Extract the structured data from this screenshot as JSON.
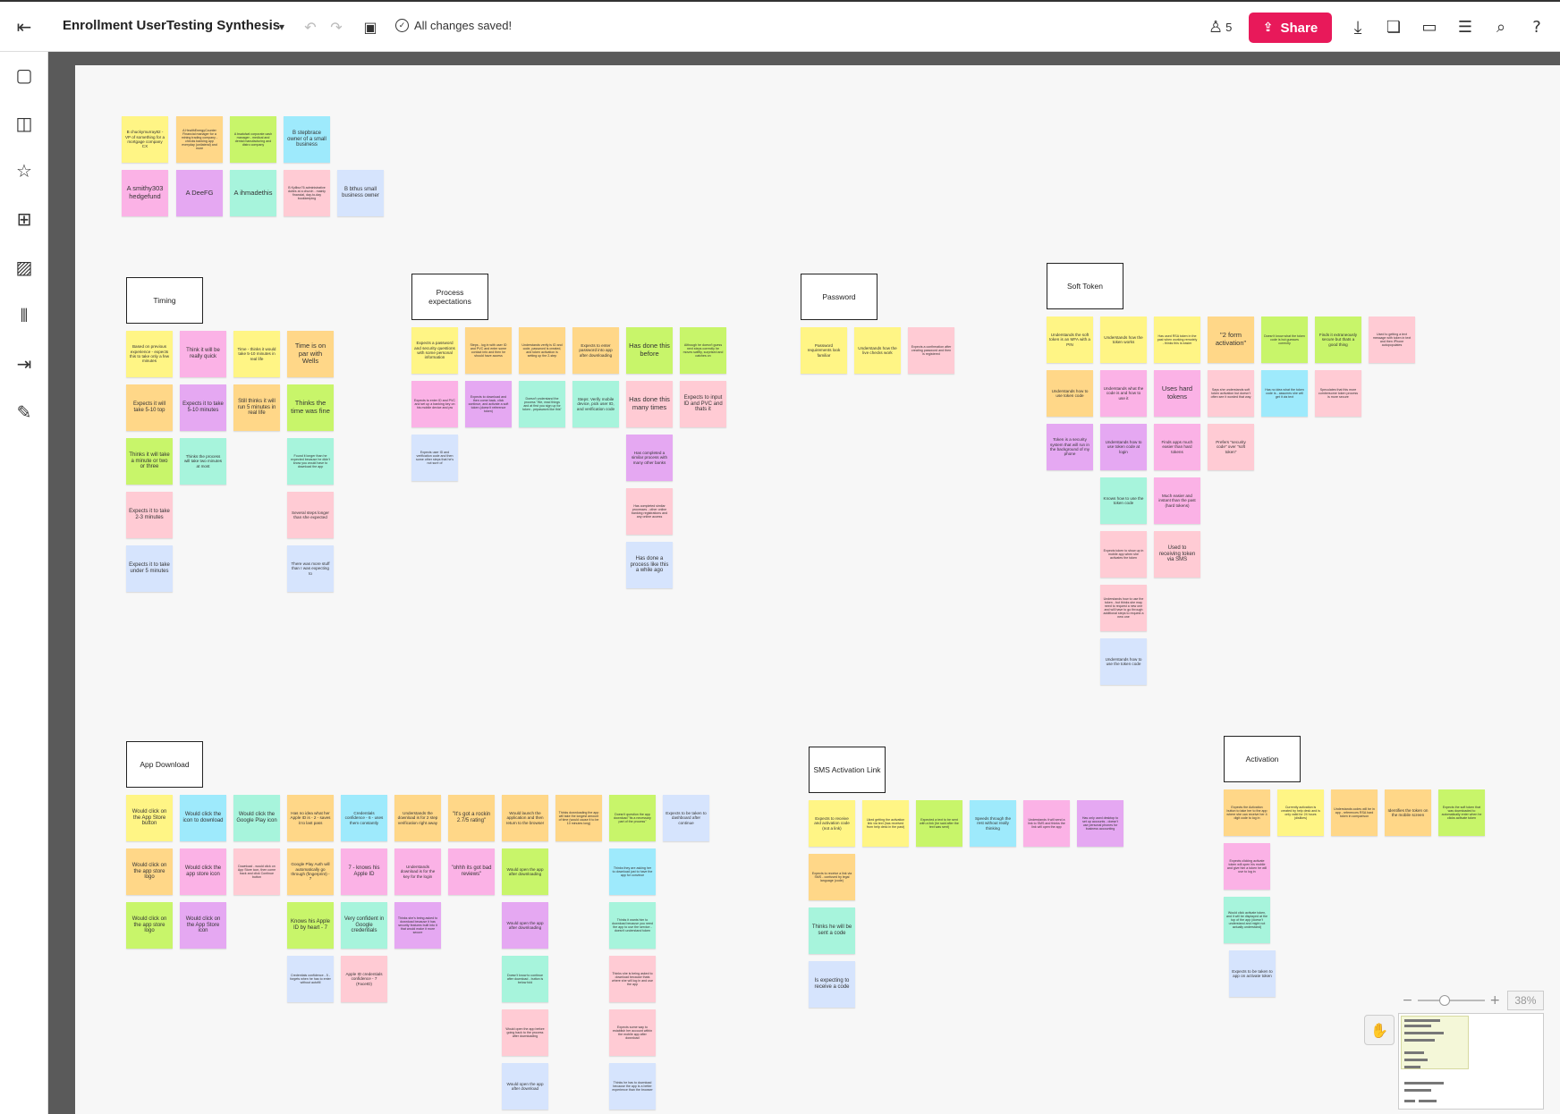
{
  "topbar": {
    "title": "Enrollment UserTesting Synthesis",
    "save_status": "All changes saved!",
    "collaborators_count": "5",
    "share_label": "Share",
    "icons": [
      "exit-icon",
      "chevron-down-icon",
      "undo-icon",
      "redo-icon",
      "present-icon",
      "check-circle-icon",
      "person-icon",
      "share-upload-icon",
      "download-icon",
      "comments-icon",
      "chat-icon",
      "activity-icon",
      "search-icon",
      "help-icon"
    ]
  },
  "leftbar": {
    "icons": [
      "sticky-note-icon",
      "shapes-icon",
      "star-icon",
      "grid-icon",
      "image-icon",
      "library-icon",
      "import-icon",
      "pen-icon"
    ]
  },
  "participants": {
    "row1": [
      {
        "text": "B chuckymurray82 - VP of something for a mortgage company CX",
        "color": "yellow"
      },
      {
        "text": "A HealthEnergyCounter Financial manager for a mining trading company - checks banking app everyday (unilateral) and more",
        "color": "orange"
      },
      {
        "text": "A bsatulwd corporate cash manager - medical and dental manufacturing and distro company",
        "color": "green"
      },
      {
        "text": "B stepbrace owner of a small business",
        "color": "cyan"
      }
    ],
    "row2": [
      {
        "text": "A smithy303 hedgefund",
        "color": "pink"
      },
      {
        "text": "A DeeFG",
        "color": "purple"
      },
      {
        "text": "A ihmadethis",
        "color": "teal"
      },
      {
        "text": "B Kyllbur76 administrative duties at a church - mainly financial, day-to-day bookkeeping",
        "color": "salmon"
      },
      {
        "text": "B bthus small business owner",
        "color": "blue"
      }
    ]
  },
  "timing": {
    "label": "Timing",
    "columns": [
      [
        {
          "text": "Based on previous experience - expects this to take only a few minutes",
          "color": "yellow"
        },
        {
          "text": "Expects it will take 5-10 top",
          "color": "orange"
        },
        {
          "text": "Thinks it will take a minute or two or three",
          "color": "green"
        },
        {
          "text": "Expects it to take 2-3 minutes",
          "color": "salmon"
        },
        {
          "text": "Expects it to take under 5 minutes",
          "color": "blue"
        }
      ],
      [
        {
          "text": "Think it will be really quick",
          "color": "pink"
        },
        {
          "text": "Expects it to take 5-10 minutes",
          "color": "purple"
        },
        {
          "text": "Thinks the process will take two minutes at most",
          "color": "teal"
        }
      ],
      [
        {
          "text": "Time - thinks it would take 5-10 minutes in real life",
          "color": "yellow"
        },
        {
          "text": "Still thinks it will run 5 minutes in real life",
          "color": "orange"
        }
      ],
      [
        {
          "text": "Time is on par with Wells",
          "color": "orange"
        },
        {
          "text": "Thinks the time was fine",
          "color": "green"
        },
        {
          "text": "Found it longer than he expected because he didn't know you would have to download the app",
          "color": "teal"
        },
        {
          "text": "Several steps longer than she expected",
          "color": "salmon"
        },
        {
          "text": "There was more stuff than I was expecting to",
          "color": "blue"
        }
      ]
    ]
  },
  "process": {
    "label": "Process expectations",
    "row1": [
      {
        "text": "Expects a password and security questions with some personal information",
        "color": "yellow"
      },
      {
        "text": "Steps - log in with user ID and PVC and enter some contact info and then he should have access",
        "color": "orange"
      },
      {
        "text": "Understands verify is ID and code, password is created, and token activation is setting up the 2-step",
        "color": "orange"
      },
      {
        "text": "Expects to enter password into app after downloading",
        "color": "orange"
      },
      {
        "text": "Has done this before",
        "color": "green"
      },
      {
        "text": "Although he doesn't guess next steps correctly he moves swiftly, surprised and catches on",
        "color": "green"
      }
    ],
    "row2": [
      {
        "text": "Expects to enter ID and PVC and set up a banking key on his mobile device and pw",
        "color": "pink"
      },
      {
        "text": "Expects to download and then come back, click continue, and activate a soft token (doesn't reference token)",
        "color": "purple"
      },
      {
        "text": "Doesn't understand the process \"We, read things and at first you sign up for token - pepaswork like this\"",
        "color": "teal"
      },
      {
        "text": "Steps: Verify mobile device, pick user ID, and verification code",
        "color": "teal"
      },
      {
        "text": "Has done this many times",
        "color": "salmon"
      },
      {
        "text": "Expects to input ID and PVC and thats it",
        "color": "salmon"
      }
    ],
    "extra_left": {
      "text": "Expects user ID and verification code and then some other steps that he's not sure of",
      "color": "blue"
    },
    "column": [
      {
        "text": "Has completed a similar process with many other banks",
        "color": "purple"
      },
      {
        "text": "Has completed similar processes - other online banking registrations and any online access",
        "color": "salmon"
      },
      {
        "text": "Has done a process like this a while ago",
        "color": "blue"
      }
    ]
  },
  "password": {
    "label": "Password",
    "notes": [
      {
        "text": "Password requirements look familiar",
        "color": "yellow"
      },
      {
        "text": "Understands how the live checks work",
        "color": "yellow"
      },
      {
        "text": "Expects a confirmation after creating password and then is registered",
        "color": "salmon"
      }
    ]
  },
  "soft_token": {
    "label": "Soft Token",
    "row1": [
      {
        "text": "Understands the soft token is an MFA with a PIN",
        "color": "yellow"
      },
      {
        "text": "Understands how the token works",
        "color": "yellow"
      },
      {
        "text": "Has used RSA token in the past when working remotely - thinks this is easier",
        "color": "yellow"
      },
      {
        "text": "\"2 form activation\"",
        "color": "orange"
      },
      {
        "text": "Doesn't know what the token code is but guesses correctly",
        "color": "green"
      },
      {
        "text": "Finds it extraneously secure but thats a good thing",
        "color": "green"
      },
      {
        "text": "Used to getting a text message with token in text and then iPhone autopopulates",
        "color": "salmon"
      }
    ],
    "row2": [
      {
        "text": "Understands how to use token code",
        "color": "orange"
      },
      {
        "text": "Understands what the code is and how to use it",
        "color": "pink"
      },
      {
        "text": "Uses hard tokens",
        "color": "pink"
      },
      {
        "text": "Says she understands soft token activation but doesn't often see it worded that way",
        "color": "salmon"
      },
      {
        "text": "Has no idea what the token code is - assumes she will get it via text",
        "color": "cyan"
      },
      {
        "text": "Speculates that this more cumbersome token process is more secure",
        "color": "salmon"
      }
    ],
    "row3": [
      {
        "text": "Token is a security system that will run in the background of my phone",
        "color": "purple"
      },
      {
        "text": "Understands how to use token code at login",
        "color": "purple"
      },
      {
        "text": "Finds apps much easier than hard tokens",
        "color": "pink"
      },
      {
        "text": "Prefers \"security code\" over \"soft token\"",
        "color": "salmon"
      }
    ],
    "col_a": [
      {
        "text": "Knows how to use the token code",
        "color": "teal"
      },
      {
        "text": "Expects token to show up in mobile app when she activates the token",
        "color": "salmon"
      },
      {
        "text": "Understands how to use the token - but thinks she may need to request a new one and will have to go through additional steps to request a new one",
        "color": "salmon"
      },
      {
        "text": "Understands how to use the token code",
        "color": "blue"
      }
    ],
    "col_b": [
      {
        "text": "Much easier and instant than the past (hard tokens)",
        "color": "pink"
      },
      {
        "text": "Used to receiving token via SMS",
        "color": "salmon"
      }
    ]
  },
  "app_download": {
    "label": "App Download",
    "columns": [
      [
        {
          "text": "Would click on the App Store button",
          "color": "yellow"
        },
        {
          "text": "Would click on the app store logo",
          "color": "orange"
        },
        {
          "text": "Would click on the app store logo",
          "color": "green"
        }
      ],
      [
        {
          "text": "Would click the icon to download",
          "color": "cyan"
        },
        {
          "text": "Would click the app store icon",
          "color": "pink"
        },
        {
          "text": "Would click on the App Store icon",
          "color": "purple"
        }
      ],
      [
        {
          "text": "Would click the Google Play icon",
          "color": "teal"
        },
        {
          "text": "Download - would click on App Store icon, then come back and click Continue button",
          "color": "salmon"
        }
      ],
      [
        {
          "text": "Has no idea what her Apple ID is - 2 - saves it to last pass",
          "color": "orange"
        },
        {
          "text": "Google Play Auth will automatically go through (fingerprint) - 7",
          "color": "orange"
        },
        {
          "text": "Knows his Apple ID by heart - 7",
          "color": "green"
        },
        {
          "text": "Credentials confidence - 5 - forgets when he has to enter without autofill",
          "color": "blue"
        }
      ],
      [
        {
          "text": "Credentials confidence - 6 - uses them constantly",
          "color": "cyan"
        },
        {
          "text": "7 - knows his Apple ID",
          "color": "pink"
        },
        {
          "text": "Very confident in Google credentials",
          "color": "teal"
        },
        {
          "text": "Apple ID credentials confidence - 7 (FaceID)",
          "color": "salmon"
        }
      ],
      [
        {
          "text": "Understands the download is for 2 step verification right away",
          "color": "orange"
        },
        {
          "text": "Understands download is for the key for the login",
          "color": "pink"
        },
        {
          "text": "Thinks she's being asked to download because it has security features built into it that would make it more secure",
          "color": "purple"
        }
      ],
      [
        {
          "text": "\"It's got a rockin 2.7/5 rating\"",
          "color": "orange"
        },
        {
          "text": "\"ohhh its got bad reviews\"",
          "color": "pink"
        }
      ],
      [
        {
          "text": "Would launch the application and then return to the browser",
          "color": "orange"
        },
        {
          "text": "Would open the app after downloading",
          "color": "green"
        },
        {
          "text": "Would open the app after downloading",
          "color": "purple"
        },
        {
          "text": "Doesn't know to continue after download - button is below fold",
          "color": "teal"
        },
        {
          "text": "Would open the app before going back to the process after downloading",
          "color": "salmon"
        },
        {
          "text": "Would open the app after download",
          "color": "blue"
        }
      ],
      [
        {
          "text": "Thinks downloading the app will take the longest amount of time (would cause it to be 10 minutes long)",
          "color": "orange"
        }
      ],
      [
        {
          "text": "Doesn't question the app download \"its a necessary part of the process\"",
          "color": "green"
        },
        {
          "text": "Thinks they are asking her to download just to have the app for convince",
          "color": "cyan"
        },
        {
          "text": "Thinks it wants him to download because you need the app to use the service - doesn't understand token",
          "color": "teal"
        },
        {
          "text": "Thinks she is being asked to download because thats where she will log in and use the app",
          "color": "salmon"
        },
        {
          "text": "Expects some way to establish her account within the mobile app after download",
          "color": "salmon"
        },
        {
          "text": "Thinks he has to download because the app is a better experience than the browser",
          "color": "blue"
        }
      ],
      [
        {
          "text": "Expects to be taken to dashboard after continue",
          "color": "blue"
        }
      ]
    ]
  },
  "sms": {
    "label": "SMS Activation Link",
    "row1": [
      {
        "text": "Expects to receive and activation code (not a link)",
        "color": "yellow"
      },
      {
        "text": "Liked getting the activation link via text (has received from help desk in the past)",
        "color": "yellow"
      },
      {
        "text": "Expected a text to be sent with a link (he said after the text was sent)",
        "color": "green"
      },
      {
        "text": "Speeds through the rest without really thinking",
        "color": "cyan"
      },
      {
        "text": "Understands it will send a link to SMS and thinks the link will open the app",
        "color": "pink"
      },
      {
        "text": "Has only used desktop to set up accounts - doesn't use personal phones for business accounting",
        "color": "purple"
      }
    ],
    "column": [
      {
        "text": "Expects to receive a link via SMS - confused by legal language (code)",
        "color": "orange"
      },
      {
        "text": "Thinks he will be sent a code",
        "color": "teal"
      },
      {
        "text": "Is expecting to receive a code",
        "color": "blue"
      }
    ]
  },
  "activation": {
    "label": "Activation",
    "row1": [
      {
        "text": "Expects the Activation button to take her to the app where she can receive her 4 digit code to log in",
        "color": "orange"
      },
      {
        "text": "Currently activation is created by help desk and is only valid for 24 hours (dislikes)",
        "color": "yellow"
      },
      {
        "text": "Understands codes will be in app - references RSA hard token in comparison",
        "color": "orange"
      },
      {
        "text": "Identifies the token on the mobile screen",
        "color": "orange"
      },
      {
        "text": "Expects the soft token that was downloaded to automatically enter when he clicks activate token",
        "color": "green"
      }
    ],
    "column": [
      {
        "text": "Expects clicking activate token will open his mobile and give him a token he will use to log in",
        "color": "pink"
      },
      {
        "text": "Would click activate token, and it will be displayed at the top of the app (doesn't understand and might not actually understand)",
        "color": "teal"
      },
      {
        "text": "Expects to be taken to app on activate token",
        "color": "blue"
      }
    ]
  },
  "zoom": {
    "level": "38%",
    "fraction": 0.38
  },
  "colors": {
    "share": "#e8195a",
    "yellow": "#fff585",
    "orange": "#ffd788",
    "green": "#c8f56a",
    "cyan": "#9eeafc",
    "pink": "#fbb2e6",
    "purple": "#e5a8f2",
    "teal": "#a7f4dc",
    "salmon": "#ffcbd4",
    "blue": "#d6e4fd"
  }
}
